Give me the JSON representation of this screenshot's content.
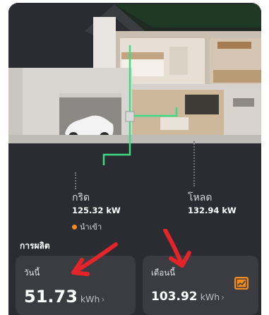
{
  "energy_flow": {
    "grid": {
      "label": "กริด",
      "value": "125.32 kW",
      "status": "นำเข้า",
      "status_color": "#f28b22"
    },
    "load": {
      "label": "โหลด",
      "value": "132.94 kW"
    }
  },
  "production": {
    "title": "การผลิต",
    "today": {
      "label": "วันนี้",
      "value": "51.73",
      "unit": "kWh"
    },
    "month": {
      "label": "เดือนนี้",
      "value": "103.92",
      "unit": "kWh"
    }
  },
  "icons": {
    "chevron": "›",
    "trend": "trend-chart-icon"
  },
  "colors": {
    "background": "#2a2c31",
    "card": "#3a3c42",
    "accent": "#f28b22",
    "flow_line": "#3ddc84",
    "annotation": "#e3242b"
  }
}
